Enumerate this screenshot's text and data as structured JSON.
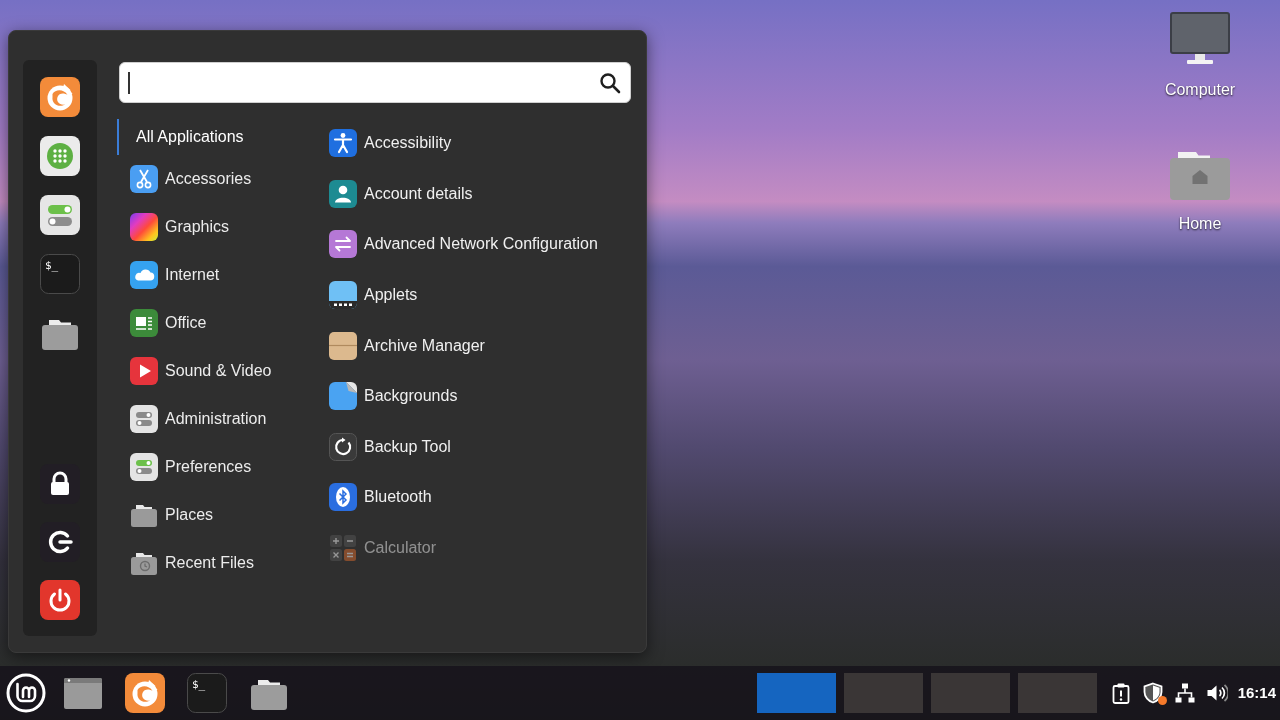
{
  "desktop": {
    "icons": [
      {
        "kind": "computer",
        "label": "Computer"
      },
      {
        "kind": "home",
        "label": "Home"
      }
    ]
  },
  "menu": {
    "favorites": [
      {
        "kind": "browser"
      },
      {
        "kind": "software"
      },
      {
        "kind": "settings"
      },
      {
        "kind": "terminal",
        "glyph": "$_"
      },
      {
        "kind": "files"
      }
    ],
    "session": [
      {
        "kind": "lock"
      },
      {
        "kind": "logout"
      },
      {
        "kind": "shutdown"
      }
    ],
    "categories": [
      {
        "kind": "all",
        "label": "All Applications",
        "selected": true
      },
      {
        "kind": "accessories",
        "label": "Accessories",
        "selected": false
      },
      {
        "kind": "graphics",
        "label": "Graphics",
        "selected": false
      },
      {
        "kind": "internet",
        "label": "Internet",
        "selected": false
      },
      {
        "kind": "office",
        "label": "Office",
        "selected": false
      },
      {
        "kind": "sound_video",
        "label": "Sound & Video",
        "selected": false
      },
      {
        "kind": "administration",
        "label": "Administration",
        "selected": false
      },
      {
        "kind": "preferences",
        "label": "Preferences",
        "selected": false
      },
      {
        "kind": "places",
        "label": "Places",
        "selected": false
      },
      {
        "kind": "recent",
        "label": "Recent Files",
        "selected": false
      }
    ],
    "applications": [
      {
        "kind": "accessibility",
        "label": "Accessibility"
      },
      {
        "kind": "account",
        "label": "Account details"
      },
      {
        "kind": "network",
        "label": "Advanced Network Configuration"
      },
      {
        "kind": "applets",
        "label": "Applets"
      },
      {
        "kind": "archive",
        "label": "Archive Manager"
      },
      {
        "kind": "backgrounds",
        "label": "Backgrounds"
      },
      {
        "kind": "backup",
        "label": "Backup Tool"
      },
      {
        "kind": "bluetooth",
        "label": "Bluetooth"
      },
      {
        "kind": "calculator",
        "label": "Calculator"
      }
    ]
  },
  "taskbar": {
    "launchers": [
      {
        "kind": "menu"
      },
      {
        "kind": "window"
      },
      {
        "kind": "browser"
      },
      {
        "kind": "terminal",
        "glyph": "$_"
      },
      {
        "kind": "files"
      }
    ],
    "workspaces": [
      {
        "selected": true
      },
      {
        "selected": false
      },
      {
        "selected": false
      },
      {
        "selected": false
      }
    ],
    "tray": [
      {
        "kind": "clipboard"
      },
      {
        "kind": "shield",
        "badge": true
      },
      {
        "kind": "network"
      },
      {
        "kind": "volume"
      }
    ],
    "clock": "16:14"
  }
}
